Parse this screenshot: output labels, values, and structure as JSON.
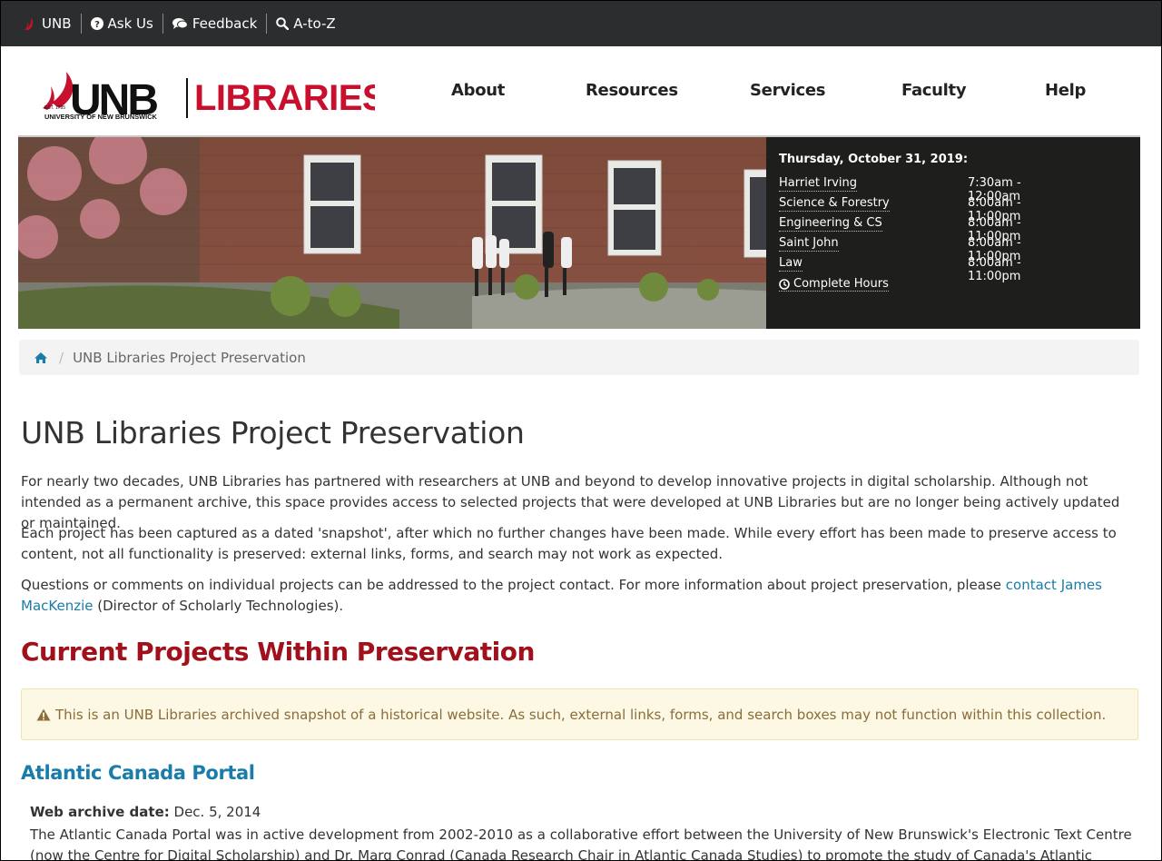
{
  "topbar": {
    "items": [
      {
        "label": "UNB",
        "icon": "unb-sail-icon"
      },
      {
        "label": "Ask Us",
        "icon": "question-circle-icon"
      },
      {
        "label": "Feedback",
        "icon": "comments-icon"
      },
      {
        "label": "A-to-Z",
        "icon": "search-icon"
      }
    ]
  },
  "logo": {
    "unb": "UNB",
    "libraries": "LIBRARIES",
    "est": "EST. 1785",
    "university": "UNIVERSITY OF NEW BRUNSWICK"
  },
  "nav": {
    "items": [
      "About",
      "Resources",
      "Services",
      "Faculty",
      "Help"
    ]
  },
  "hours": {
    "date": "Thursday, October 31, 2019:",
    "rows": [
      {
        "library": "Harriet Irving",
        "time": "7:30am - 12:00am"
      },
      {
        "library": "Science & Forestry",
        "time": "8:00am - 11:00pm"
      },
      {
        "library": "Engineering & CS",
        "time": "8:00am - 11:00pm"
      },
      {
        "library": "Saint John",
        "time": "8:00am - 11:00pm"
      },
      {
        "library": "Law",
        "time": "8:00am - 11:00pm"
      }
    ],
    "complete_label": "Complete Hours"
  },
  "breadcrumb": {
    "current": "UNB Libraries Project Preservation"
  },
  "main": {
    "title": "UNB Libraries Project Preservation",
    "para1": "For nearly two decades, UNB Libraries has partnered with researchers at UNB and beyond to develop innovative projects in digital scholarship. Although not intended as a permanent archive, this space provides access to selected projects that were developed at UNB Libraries but are no longer being actively updated or maintained.",
    "para2": "Each project has been captured as a dated 'snapshot', after which no further changes have been made. While every effort has been made to preserve access to content, not all functionality is preserved: external links, forms, and search may not work as expected.",
    "para3_prefix": "Questions or comments on individual projects can be addressed to the project contact. For more information about project preservation, please ",
    "para3_link": "contact James MacKenzie",
    "para3_suffix": " (Director of Scholarly Technologies).",
    "section_title": "Current Projects Within Preservation",
    "alert": "This is an UNB Libraries archived snapshot of a historical website. As such, external links, forms, and search boxes may not function within this collection."
  },
  "project": {
    "title": "Atlantic Canada Portal",
    "date_label": "Web archive date:",
    "date_value": "Dec. 5, 2014",
    "description": "The Atlantic Canada Portal was in active development from 2002-2010 as a collaborative effort between the University of New Brunswick's Electronic Text Centre (now the Centre for Digital Scholarship) and Dr. Marg Conrad (Canada Research Chair in Atlantic Canada Studies) to promote the study of Canada's Atlantic provinces. Content includes"
  },
  "colors": {
    "topbar_bg": "#2b2d2f",
    "brand_red": "#c8102e",
    "section_red": "#a0111b",
    "link_blue": "#1a7ca8",
    "alert_bg": "#fcf8e3",
    "alert_text": "#8a6d3b"
  }
}
